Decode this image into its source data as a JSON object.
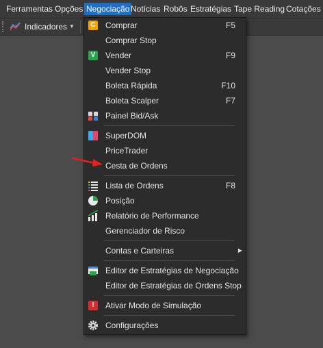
{
  "menubar": {
    "items": [
      {
        "label": "Ferramentas"
      },
      {
        "label": "Opções"
      },
      {
        "label": "Negociação"
      },
      {
        "label": "Notícias"
      },
      {
        "label": "Robôs"
      },
      {
        "label": "Estratégias"
      },
      {
        "label": "Tape Reading"
      },
      {
        "label": "Cotações"
      }
    ]
  },
  "toolbar": {
    "indicators_label": "Indicadores"
  },
  "menu": {
    "items": [
      {
        "label": "Comprar",
        "shortcut": "F5",
        "icon": "buy-c-icon"
      },
      {
        "label": "Comprar Stop",
        "shortcut": ""
      },
      {
        "label": "Vender",
        "shortcut": "F9",
        "icon": "sell-v-icon"
      },
      {
        "label": "Vender Stop",
        "shortcut": ""
      },
      {
        "label": "Boleta Rápida",
        "shortcut": "F10"
      },
      {
        "label": "Boleta Scalper",
        "shortcut": "F7"
      },
      {
        "label": "Painel Bid/Ask",
        "icon": "bid-ask-icon"
      },
      {
        "label": "SuperDOM",
        "icon": "superdom-icon"
      },
      {
        "label": "PriceTrader"
      },
      {
        "label": "Cesta de Ordens"
      },
      {
        "label": "Lista de Ordens",
        "shortcut": "F8",
        "icon": "order-list-icon"
      },
      {
        "label": "Posição",
        "icon": "pie-chart-icon"
      },
      {
        "label": "Relatório de Performance",
        "icon": "performance-chart-icon"
      },
      {
        "label": "Gerenciador de Risco"
      },
      {
        "label": "Contas e Carteiras"
      },
      {
        "label": "Editor de Estratégias de Negociação",
        "icon": "strategy-editor-icon"
      },
      {
        "label": "Editor de Estratégias de Ordens Stop"
      },
      {
        "label": "Ativar Modo de Simulação",
        "icon": "warning-icon"
      },
      {
        "label": "Configurações",
        "icon": "gear-icon"
      }
    ]
  },
  "colors": {
    "accent": "#1f6fc5",
    "buy": "#f0a30a",
    "sell": "#2aa34a",
    "alert": "#d32f2f",
    "annotation_arrow": "#e8201c"
  }
}
